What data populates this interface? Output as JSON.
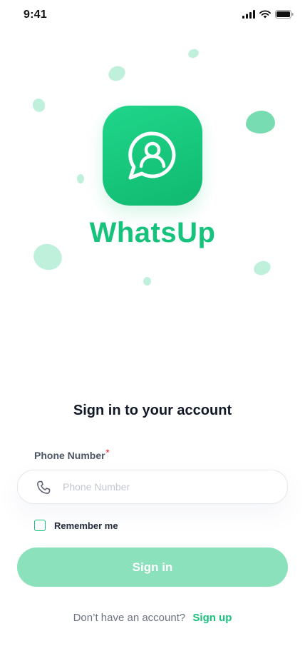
{
  "status_bar": {
    "time": "9:41",
    "icons": [
      "cellular-signal-icon",
      "wifi-icon",
      "battery-icon"
    ]
  },
  "brand": {
    "name": "WhatsUp",
    "logo_icon": "chat-bubble-user-icon",
    "color": "#16c27c"
  },
  "form": {
    "heading": "Sign in to your account",
    "phone": {
      "label": "Phone Number",
      "required_mark": "*",
      "placeholder": "Phone Number",
      "value": "",
      "icon": "phone-icon"
    },
    "remember": {
      "label": "Remember me",
      "checked": false
    },
    "submit_label": "Sign in"
  },
  "footer": {
    "text": "Don’t have an account?",
    "link": "Sign up"
  },
  "colors": {
    "accent": "#16c27c",
    "button_disabled": "#8ce1bd",
    "blob": "#bff0dc",
    "required": "#ef4444"
  }
}
